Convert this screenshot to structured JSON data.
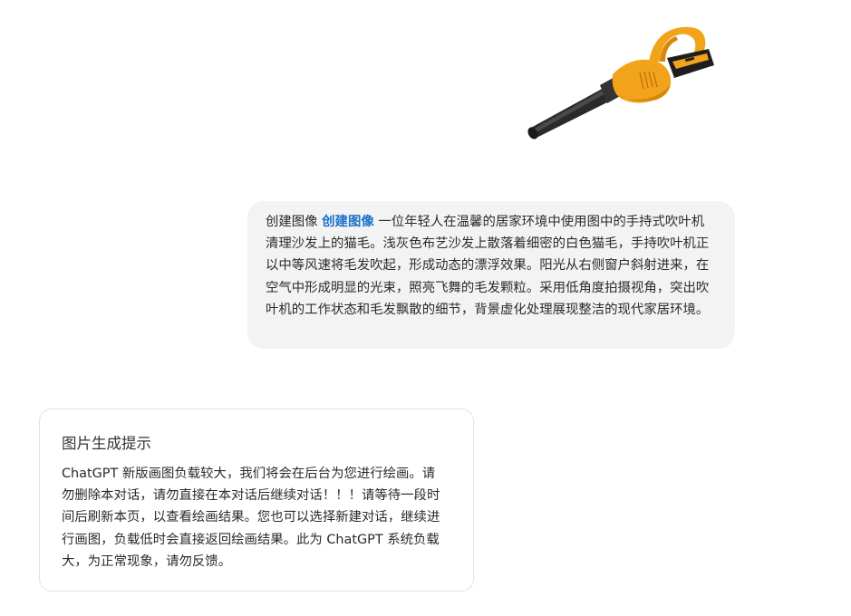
{
  "image": {
    "subject": "cordless handheld leaf blower",
    "colors": {
      "body": "#f2a31c",
      "body_dark": "#d7860c",
      "tube": "#2a2a2a",
      "battery": "#1e1e1e"
    }
  },
  "user_message": {
    "prefix": "创建图像",
    "tag": "创建图像",
    "text": "一位年轻人在温馨的居家环境中使用图中的手持式吹叶机清理沙发上的猫毛。浅灰色布艺沙发上散落着细密的白色猫毛，手持吹叶机正以中等风速将毛发吹起，形成动态的漂浮效果。阳光从右侧窗户斜射进来，在空气中形成明显的光束，照亮飞舞的毛发颗粒。采用低角度拍摄视角，突出吹叶机的工作状态和毛发飘散的细节，背景虚化处理展现整洁的现代家居环境。"
  },
  "notice": {
    "title": "图片生成提示",
    "body": "ChatGPT 新版画图负载较大，我们将会在后台为您进行绘画。请勿删除本对话，请勿直接在本对话后继续对话！！！请等待一段时间后刷新本页，以查看绘画结果。您也可以选择新建对话，继续进行画图，负载低时会直接返回绘画结果。此为 ChatGPT 系统负载大，为正常现象，请勿反馈。"
  },
  "colors": {
    "bubble_bg": "#f3f3f3",
    "tag": "#1a73c9",
    "card_border": "#e3e3e3"
  }
}
